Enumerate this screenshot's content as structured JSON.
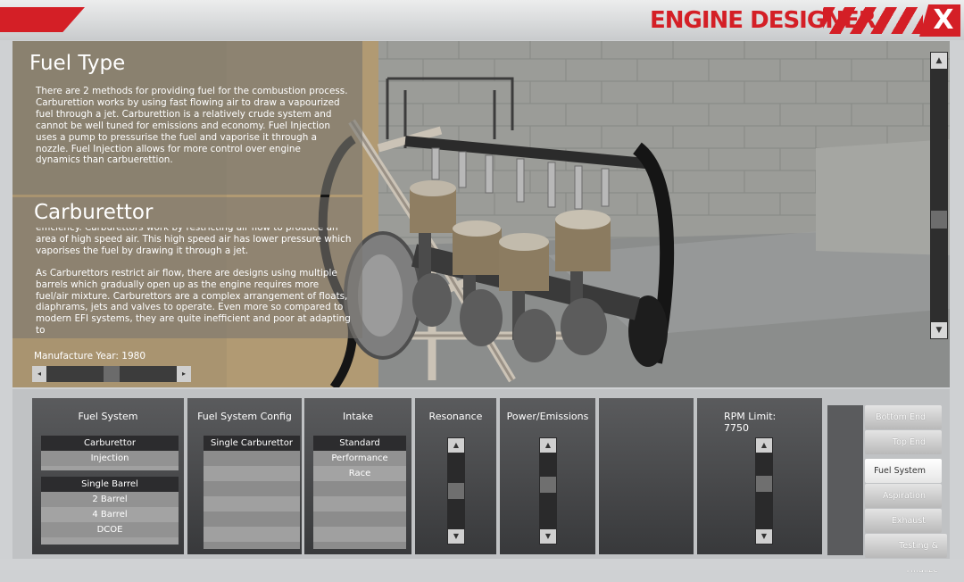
{
  "header": {
    "title": "ENGINE DESIGNER",
    "close_label": "X"
  },
  "info": {
    "fuel_type_title": "Fuel Type",
    "fuel_type_text": "There are 2 methods for providing fuel for the combustion process. Carburettion works by using fast flowing air to draw a vapourized fuel through a jet. Carburettion is a relatively crude system and cannot be well tuned for emissions and economy. Fuel Injection uses a pump to pressurise the fuel and vaporise it through a nozzle. Fuel Injection allows for more control over engine dynamics than carbuerettion.",
    "carb_title": "Carburettor",
    "carb_text_1": "efficiency. Carburettors work by restricting air flow to produce an area of high speed air. This high speed air has lower pressure which vaporises the fuel by drawing it through a jet.",
    "carb_text_2": "As Carburettors restrict air flow, there are designs using multiple barrels which gradually open up as the engine requires more fuel/air mixture. Carburettors are a complex arrangement of floats, diaphrams, jets and valves to operate. Even more so compared to modern EFI systems, they are quite inefficient and poor at adapting to",
    "manufacture_year_label": "Manufacture Year: 1980"
  },
  "fuel_system": {
    "header": "Fuel System",
    "types": [
      "Carburettor",
      "Injection"
    ],
    "selected_type": "Carburettor",
    "barrels": [
      "Single Barrel",
      "2 Barrel",
      "4 Barrel",
      "DCOE"
    ],
    "selected_barrel": "Single Barrel"
  },
  "fuel_system_config": {
    "header": "Fuel System Config",
    "items": [
      "Single Carburettor"
    ]
  },
  "intake": {
    "header": "Intake",
    "items": [
      "Standard",
      "Performance",
      "Race"
    ],
    "selected": "Standard"
  },
  "resonance": {
    "header": "Resonance",
    "level": 0.5
  },
  "power_emissions": {
    "header": "Power/Emissions",
    "level": 0.6
  },
  "rpm_limit": {
    "header": "RPM Limit:",
    "value": "7750",
    "level": 0.62
  },
  "tabs": [
    {
      "label": "Bottom End",
      "active": false
    },
    {
      "label": "Top End",
      "active": false
    },
    {
      "label": "Fuel System",
      "active": true
    },
    {
      "label": "Aspiration",
      "active": false
    },
    {
      "label": "Exhaust",
      "active": false
    },
    {
      "label": "Testing & Finalize",
      "active": false
    }
  ],
  "colors": {
    "accent": "#d41f26"
  },
  "icons": {
    "scroll_up": "up-arrow-icon",
    "scroll_down": "down-arrow-icon",
    "close": "close-icon"
  }
}
